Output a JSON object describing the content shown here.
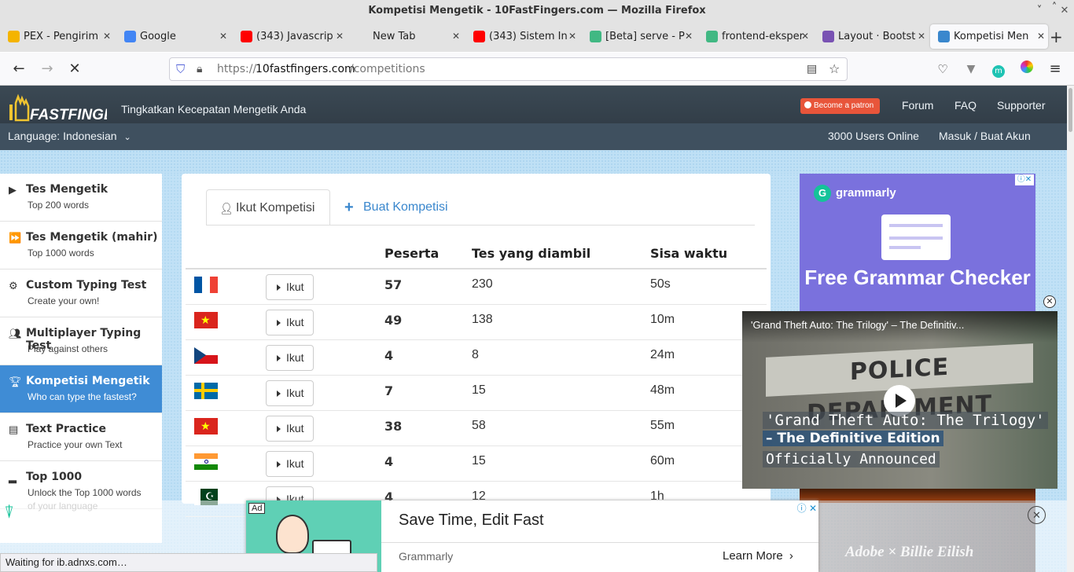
{
  "window": {
    "title": "Kompetisi Mengetik - 10FastFingers.com — Mozilla Firefox"
  },
  "tabs": [
    {
      "label": "PEX - Pengirim",
      "icon": "pex-icon",
      "color": "#f4b400"
    },
    {
      "label": "Google",
      "icon": "google-icon",
      "color": "#4285f4"
    },
    {
      "label": "(343) Javascrip",
      "icon": "youtube-icon",
      "color": "#ff0000"
    },
    {
      "label": "New Tab",
      "icon": "",
      "color": ""
    },
    {
      "label": "(343) Sistem In",
      "icon": "youtube-icon",
      "color": "#ff0000"
    },
    {
      "label": "[Beta] serve - P",
      "icon": "vue-icon",
      "color": "#41b883"
    },
    {
      "label": "frontend-eksper",
      "icon": "vue-icon",
      "color": "#41b883"
    },
    {
      "label": "Layout · Bootst",
      "icon": "bootstrap-icon",
      "color": "#7952b3"
    },
    {
      "label": "Kompetisi Men",
      "icon": "fastfingers-icon",
      "color": "#3a87cd"
    }
  ],
  "url": {
    "prefix": "https://",
    "host": "10fastfingers.com",
    "path": "/competitions"
  },
  "site": {
    "tagline": "Tingkatkan Kecepatan Mengetik Anda",
    "patron": "Become a patron",
    "nav": [
      "Forum",
      "FAQ",
      "Supporter"
    ],
    "language": "Language: Indonesian",
    "users_online": "3000 Users Online",
    "login": "Masuk / Buat Akun"
  },
  "sidebar": [
    {
      "title": "Tes Mengetik",
      "sub": "Top 200 words",
      "icon": "play-icon"
    },
    {
      "title": "Tes Mengetik (mahir)",
      "sub": "Top 1000 words",
      "icon": "fast-forward-icon"
    },
    {
      "title": "Custom Typing Test",
      "sub": "Create your own!",
      "icon": "gears-icon"
    },
    {
      "title": "Multiplayer Typing Test",
      "sub": "Play against others",
      "icon": "users-icon"
    },
    {
      "title": "Kompetisi Mengetik",
      "sub": "Who can type the fastest?",
      "icon": "trophy-icon",
      "active": true
    },
    {
      "title": "Text Practice",
      "sub": "Practice your own Text",
      "icon": "document-icon"
    },
    {
      "title": "Top 1000",
      "sub": "Unlock the Top 1000 words",
      "sub2": "of your language",
      "icon": "signal-icon"
    }
  ],
  "panel": {
    "tab_join": "Ikut Kompetisi",
    "tab_create": "Buat Kompetisi",
    "headers": [
      "Peserta",
      "Tes yang diambil",
      "Sisa waktu"
    ],
    "join_label": "Ikut",
    "rows": [
      {
        "flag": "france",
        "peserta": "57",
        "tes": "230",
        "sisa": "50s"
      },
      {
        "flag": "vietnam",
        "peserta": "49",
        "tes": "138",
        "sisa": "10m"
      },
      {
        "flag": "czech",
        "peserta": "4",
        "tes": "8",
        "sisa": "24m"
      },
      {
        "flag": "sweden",
        "peserta": "7",
        "tes": "15",
        "sisa": "48m"
      },
      {
        "flag": "vietnam",
        "peserta": "38",
        "tes": "58",
        "sisa": "55m"
      },
      {
        "flag": "india",
        "peserta": "4",
        "tes": "15",
        "sisa": "60m"
      },
      {
        "flag": "pakistan",
        "peserta": "4",
        "tes": "12",
        "sisa": "1h"
      }
    ]
  },
  "grammarly_ad": {
    "brand": "grammarly",
    "headline": "Free Grammar Checker"
  },
  "video": {
    "title": "'Grand Theft Auto: The Trilogy' – The Definitiv...",
    "line1": "'Grand Theft Auto: The Trilogy'",
    "line2": "– The Definitive Edition",
    "line3": "Officially Announced",
    "bg_text": "POLICE DEPARTMENT"
  },
  "bottom_ad": {
    "badge": "Ad",
    "headline": "Save Time, Edit Fast",
    "brand": "Grammarly",
    "cta": "Learn More",
    "right_text": "Adobe  ×  Billie Eilish"
  },
  "status": "Waiting for ib.adnxs.com…"
}
